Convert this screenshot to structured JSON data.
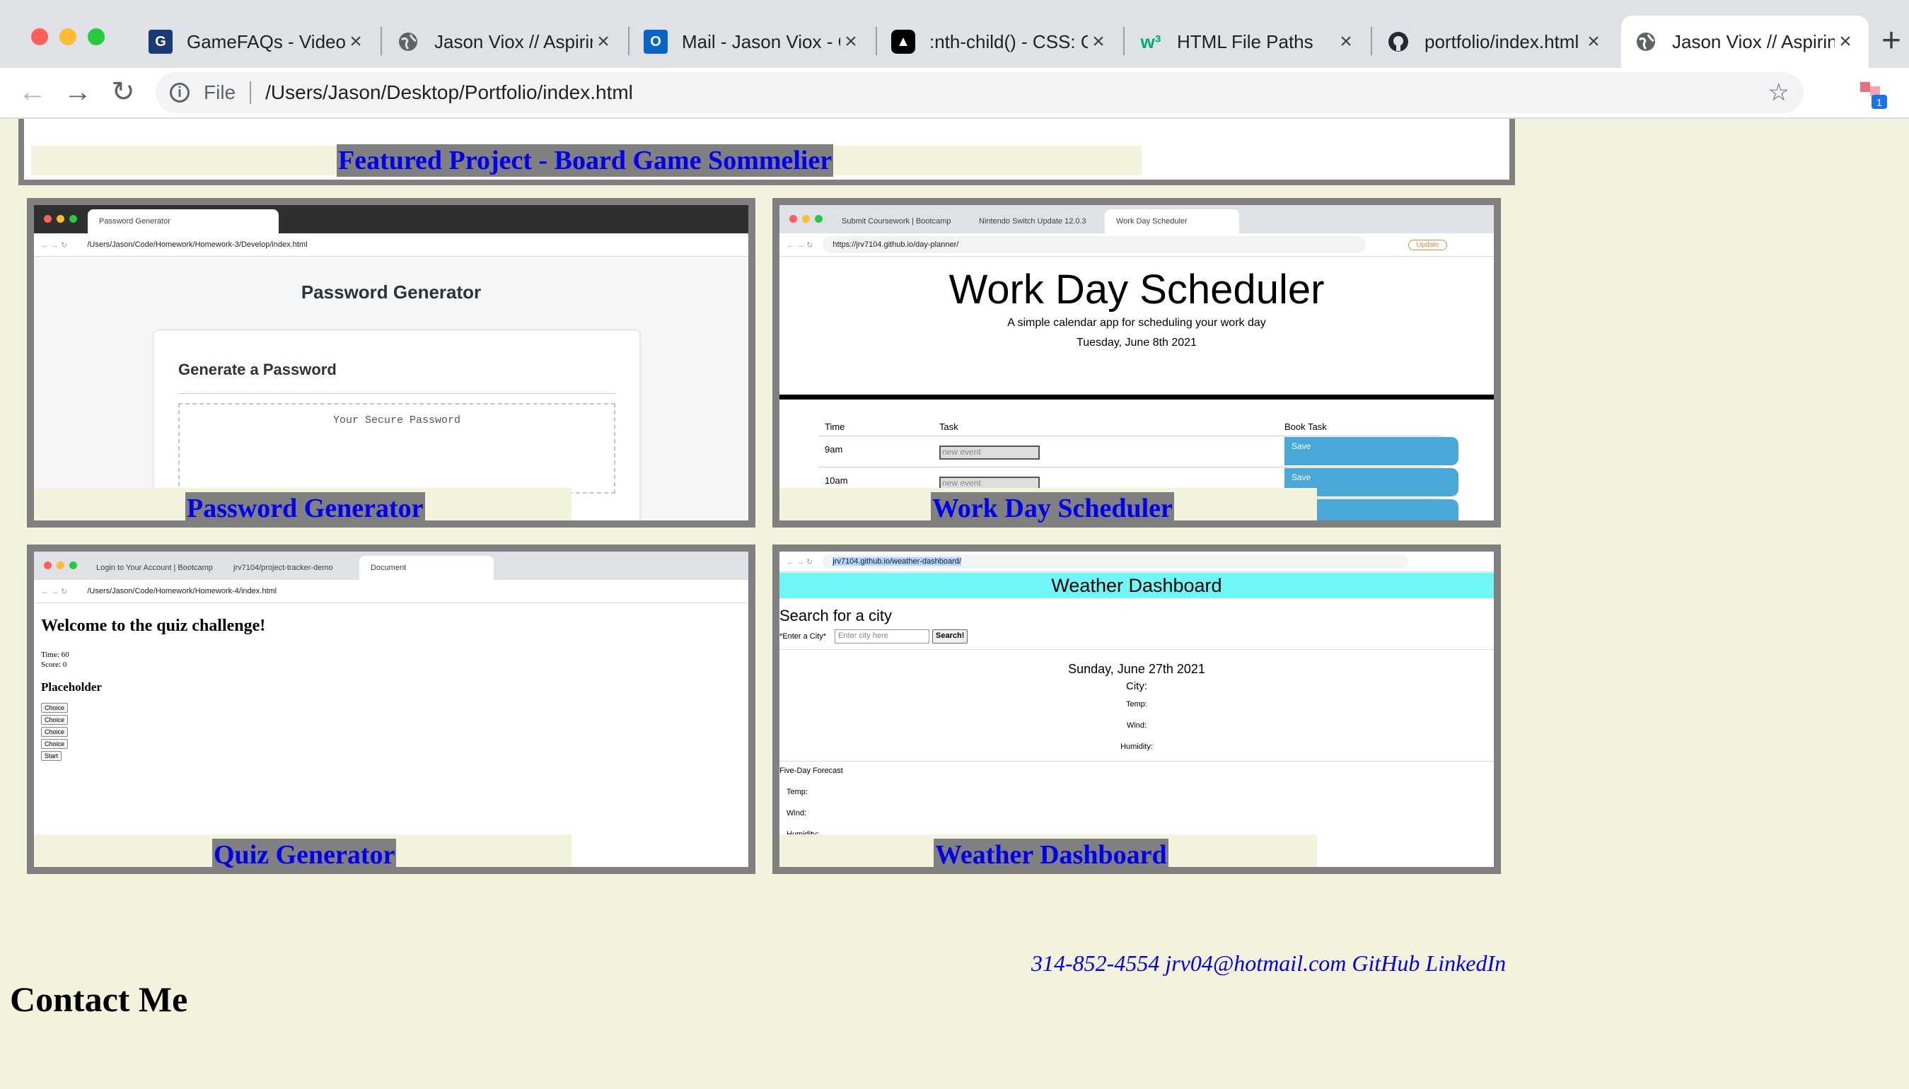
{
  "browser": {
    "tabs": [
      {
        "title": "GameFAQs - Video Game Cheats",
        "favicon": "gamefaqs-icon"
      },
      {
        "title": "Jason Viox // Aspiring Developer",
        "favicon": "globe-icon"
      },
      {
        "title": "Mail - Jason Viox - Outlook",
        "favicon": "outlook-icon"
      },
      {
        "title": ":nth-child() - CSS: Cascading",
        "favicon": "mdn-icon"
      },
      {
        "title": "HTML File Paths",
        "favicon": "w3schools-icon"
      },
      {
        "title": "portfolio/index.html",
        "favicon": "github-icon"
      },
      {
        "title": "Jason Viox // Aspiring Developer",
        "favicon": "globe-icon"
      }
    ],
    "new_tab_label": "+",
    "address": {
      "scheme_label": "File",
      "url": "/Users/Jason/Desktop/Portfolio/index.html"
    },
    "extension_badge": "1"
  },
  "page": {
    "featured_caption": "Featured Project - Board Game Sommelier",
    "projects": [
      {
        "caption": "Password Generator"
      },
      {
        "caption": "Work Day Scheduler"
      },
      {
        "caption": "Quiz Generator"
      },
      {
        "caption": "Weather Dashboard"
      }
    ],
    "contact": {
      "phone": "314-852-4554",
      "email": "jrv04@hotmail.com",
      "github": "GitHub",
      "linkedin": "LinkedIn",
      "heading": "Contact Me"
    }
  },
  "screenshots": {
    "password": {
      "tab": "Password Generator",
      "url": "/Users/Jason/Code/Homework/Homework-3/Develop/index.html",
      "heading": "Password Generator",
      "card_title": "Generate a Password",
      "placeholder": "Your Secure Password"
    },
    "scheduler": {
      "tabs": [
        "Submit Coursework | Bootcamp",
        "Nintendo Switch Update 12.0.3",
        "Work Day Scheduler"
      ],
      "url": "https://jrv7104.github.io/day-planner/",
      "update_label": "Update",
      "title": "Work Day Scheduler",
      "subtitle": "A simple calendar app for scheduling your work day",
      "date": "Tuesday, June 8th 2021",
      "columns": [
        "Time",
        "Task",
        "Book Task"
      ],
      "rows": [
        {
          "time": "9am",
          "task": "new event",
          "action": "Save"
        },
        {
          "time": "10am",
          "task": "new event",
          "action": "Save"
        }
      ]
    },
    "quiz": {
      "tabs": [
        "Login to Your Account | Bootcamp",
        "jrv7104/project-tracker-demo",
        "Document"
      ],
      "url": "/Users/Jason/Code/Homework/Homework-4/index.html",
      "heading": "Welcome to the quiz challenge!",
      "time": "Time: 60",
      "score": "Score: 0",
      "question": "Placeholder",
      "choices": [
        "Choice",
        "Choice",
        "Choice",
        "Choice"
      ],
      "start": "Start"
    },
    "weather": {
      "url": "jrv7104.github.io/weather-dashboard/",
      "banner": "Weather Dashboard",
      "search_heading": "Search for a city",
      "label": "*Enter a City*",
      "placeholder": "Enter city here",
      "button": "Search!",
      "date": "Sunday, June 27th 2021",
      "city": "City:",
      "temp": "Temp:",
      "wind": "Wind:",
      "humidity": "Humidity:",
      "forecast": "Five-Day Forecast"
    }
  },
  "colors": {
    "page_bg": "#f3f2dd",
    "link": "#0000ee",
    "frame": "#808080",
    "save_button": "#4aa8d8",
    "weather_banner": "#6ff7f7"
  }
}
